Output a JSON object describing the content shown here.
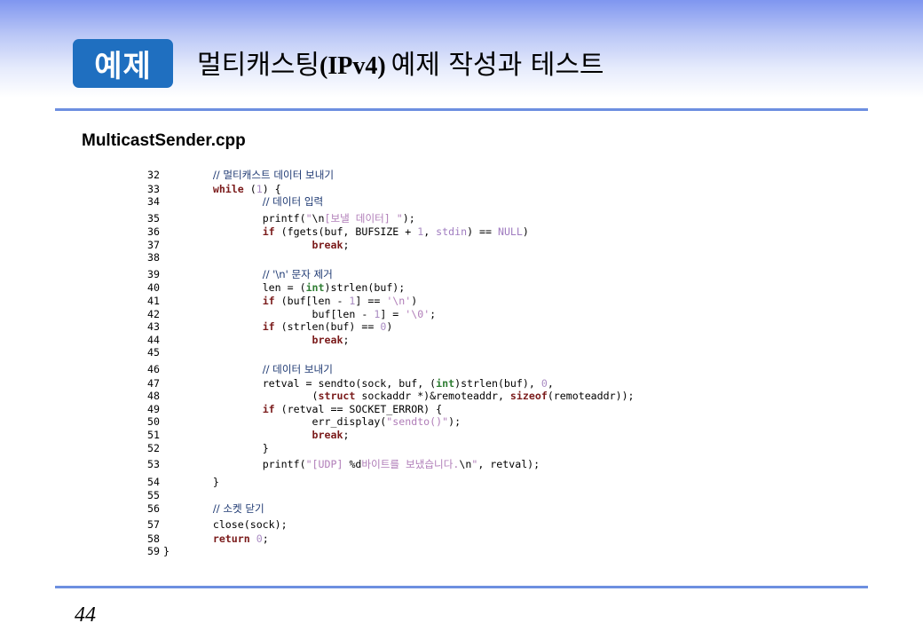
{
  "header": {
    "badge": "예제",
    "title_before": "멀티캐스팅",
    "title_ipv4": "(IPv4)",
    "title_after": "예제 작성과 테스트"
  },
  "filename": "MulticastSender.cpp",
  "code_lines": [
    {
      "n": "32",
      "tall": true,
      "parts": [
        {
          "c": "sp",
          "t": "        "
        },
        {
          "c": "cm",
          "t": "// 멀티캐스트 데이터 보내기"
        }
      ]
    },
    {
      "n": "33",
      "parts": [
        {
          "c": "sp",
          "t": "        "
        },
        {
          "c": "kw",
          "t": "while"
        },
        {
          "c": "pn",
          "t": " ("
        },
        {
          "c": "num",
          "t": "1"
        },
        {
          "c": "pn",
          "t": ") {"
        }
      ]
    },
    {
      "n": "34",
      "parts": [
        {
          "c": "sp",
          "t": "                "
        },
        {
          "c": "cm",
          "t": "// 데이터 입력"
        }
      ]
    },
    {
      "n": "35",
      "tall": true,
      "parts": [
        {
          "c": "sp",
          "t": "                "
        },
        {
          "c": "pn",
          "t": "printf("
        },
        {
          "c": "str",
          "t": "\""
        },
        {
          "c": "pn",
          "t": "\\n"
        },
        {
          "c": "str",
          "t": "[보낼 데이터] \""
        },
        {
          "c": "pn",
          "t": ");"
        }
      ]
    },
    {
      "n": "36",
      "parts": [
        {
          "c": "sp",
          "t": "                "
        },
        {
          "c": "kw",
          "t": "if"
        },
        {
          "c": "pn",
          "t": " (fgets(buf, BUFSIZE + "
        },
        {
          "c": "num",
          "t": "1"
        },
        {
          "c": "pn",
          "t": ", "
        },
        {
          "c": "mac",
          "t": "stdin"
        },
        {
          "c": "pn",
          "t": ") == "
        },
        {
          "c": "mac",
          "t": "NULL"
        },
        {
          "c": "pn",
          "t": ")"
        }
      ]
    },
    {
      "n": "37",
      "parts": [
        {
          "c": "sp",
          "t": "                        "
        },
        {
          "c": "kw",
          "t": "break"
        },
        {
          "c": "pn",
          "t": ";"
        }
      ]
    },
    {
      "n": "38",
      "parts": []
    },
    {
      "n": "39",
      "tall": true,
      "parts": [
        {
          "c": "sp",
          "t": "                "
        },
        {
          "c": "cm",
          "t": "// '\\n' 문자 제거"
        }
      ]
    },
    {
      "n": "40",
      "parts": [
        {
          "c": "sp",
          "t": "                "
        },
        {
          "c": "pn",
          "t": "len = ("
        },
        {
          "c": "ty",
          "t": "int"
        },
        {
          "c": "pn",
          "t": ")strlen(buf);"
        }
      ]
    },
    {
      "n": "41",
      "parts": [
        {
          "c": "sp",
          "t": "                "
        },
        {
          "c": "kw",
          "t": "if"
        },
        {
          "c": "pn",
          "t": " (buf[len - "
        },
        {
          "c": "num",
          "t": "1"
        },
        {
          "c": "pn",
          "t": "] == "
        },
        {
          "c": "str",
          "t": "'\\n'"
        },
        {
          "c": "pn",
          "t": ")"
        }
      ]
    },
    {
      "n": "42",
      "parts": [
        {
          "c": "sp",
          "t": "                        "
        },
        {
          "c": "pn",
          "t": "buf[len - "
        },
        {
          "c": "num",
          "t": "1"
        },
        {
          "c": "pn",
          "t": "] = "
        },
        {
          "c": "str",
          "t": "'\\0'"
        },
        {
          "c": "pn",
          "t": ";"
        }
      ]
    },
    {
      "n": "43",
      "parts": [
        {
          "c": "sp",
          "t": "                "
        },
        {
          "c": "kw",
          "t": "if"
        },
        {
          "c": "pn",
          "t": " (strlen(buf) == "
        },
        {
          "c": "num",
          "t": "0"
        },
        {
          "c": "pn",
          "t": ")"
        }
      ]
    },
    {
      "n": "44",
      "parts": [
        {
          "c": "sp",
          "t": "                        "
        },
        {
          "c": "kw",
          "t": "break"
        },
        {
          "c": "pn",
          "t": ";"
        }
      ]
    },
    {
      "n": "45",
      "parts": []
    },
    {
      "n": "46",
      "tall": true,
      "parts": [
        {
          "c": "sp",
          "t": "                "
        },
        {
          "c": "cm",
          "t": "// 데이터 보내기"
        }
      ]
    },
    {
      "n": "47",
      "parts": [
        {
          "c": "sp",
          "t": "                "
        },
        {
          "c": "pn",
          "t": "retval = sendto(sock, buf, ("
        },
        {
          "c": "ty",
          "t": "int"
        },
        {
          "c": "pn",
          "t": ")strlen(buf), "
        },
        {
          "c": "num",
          "t": "0"
        },
        {
          "c": "pn",
          "t": ","
        }
      ]
    },
    {
      "n": "48",
      "parts": [
        {
          "c": "sp",
          "t": "                        "
        },
        {
          "c": "pn",
          "t": "("
        },
        {
          "c": "kw",
          "t": "struct"
        },
        {
          "c": "pn",
          "t": " sockaddr *)&remoteaddr, "
        },
        {
          "c": "kw",
          "t": "sizeof"
        },
        {
          "c": "pn",
          "t": "(remoteaddr));"
        }
      ]
    },
    {
      "n": "49",
      "parts": [
        {
          "c": "sp",
          "t": "                "
        },
        {
          "c": "kw",
          "t": "if"
        },
        {
          "c": "pn",
          "t": " (retval == SOCKET_ERROR) {"
        }
      ]
    },
    {
      "n": "50",
      "parts": [
        {
          "c": "sp",
          "t": "                        "
        },
        {
          "c": "pn",
          "t": "err_display("
        },
        {
          "c": "str",
          "t": "\"sendto()\""
        },
        {
          "c": "pn",
          "t": ");"
        }
      ]
    },
    {
      "n": "51",
      "parts": [
        {
          "c": "sp",
          "t": "                        "
        },
        {
          "c": "kw",
          "t": "break"
        },
        {
          "c": "pn",
          "t": ";"
        }
      ]
    },
    {
      "n": "52",
      "parts": [
        {
          "c": "sp",
          "t": "                "
        },
        {
          "c": "pn",
          "t": "}"
        }
      ]
    },
    {
      "n": "53",
      "tall": true,
      "parts": [
        {
          "c": "sp",
          "t": "                "
        },
        {
          "c": "pn",
          "t": "printf("
        },
        {
          "c": "str",
          "t": "\"[UDP] "
        },
        {
          "c": "pn",
          "t": "%d"
        },
        {
          "c": "str",
          "t": "바이트를 보냈습니다."
        },
        {
          "c": "pn",
          "t": "\\n"
        },
        {
          "c": "str",
          "t": "\""
        },
        {
          "c": "pn",
          "t": ", retval);"
        }
      ]
    },
    {
      "n": "54",
      "tall": true,
      "parts": [
        {
          "c": "sp",
          "t": "        "
        },
        {
          "c": "pn",
          "t": "}"
        }
      ]
    },
    {
      "n": "55",
      "parts": []
    },
    {
      "n": "56",
      "parts": [
        {
          "c": "sp",
          "t": "        "
        },
        {
          "c": "cm",
          "t": "// 소켓 닫기"
        }
      ]
    },
    {
      "n": "57",
      "tall": true,
      "parts": [
        {
          "c": "sp",
          "t": "        "
        },
        {
          "c": "pn",
          "t": "close(sock);"
        }
      ]
    },
    {
      "n": "58",
      "parts": [
        {
          "c": "sp",
          "t": "        "
        },
        {
          "c": "kw",
          "t": "return"
        },
        {
          "c": "pn",
          "t": " "
        },
        {
          "c": "num",
          "t": "0"
        },
        {
          "c": "pn",
          "t": ";"
        }
      ]
    },
    {
      "n": "59",
      "parts": [
        {
          "c": "pn",
          "t": "}"
        }
      ]
    }
  ],
  "page_number": "44"
}
